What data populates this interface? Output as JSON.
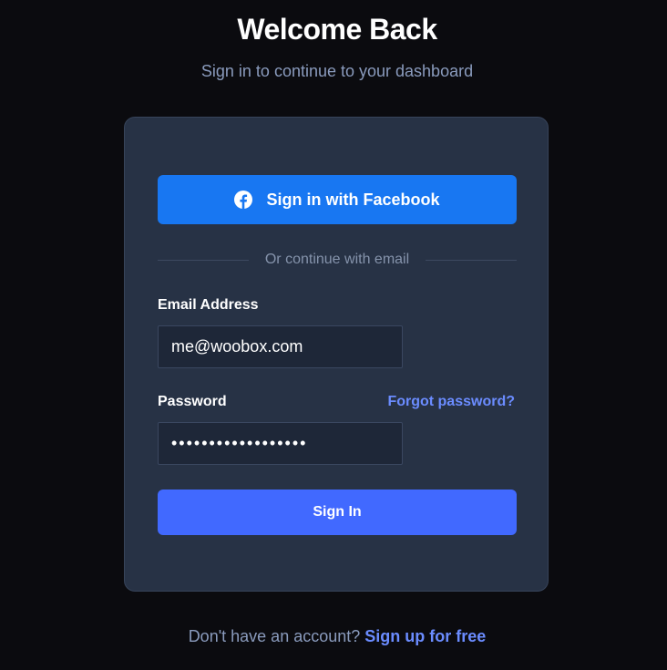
{
  "header": {
    "title": "Welcome Back",
    "subtitle": "Sign in to continue to your dashboard"
  },
  "form": {
    "facebook_button_label": "Sign in with Facebook",
    "facebook_icon": "facebook-icon",
    "divider_text": "Or continue with email",
    "email_label": "Email Address",
    "email_value": "me@woobox.com",
    "password_label": "Password",
    "forgot_password_label": "Forgot password?",
    "password_value": "••••••••••••••••••",
    "signin_button_label": "Sign In"
  },
  "footer": {
    "prompt": "Don't have an account?",
    "signup_label": "Sign up for free"
  },
  "colors": {
    "background": "#0b0b0f",
    "card": "#273245",
    "facebook_blue": "#1877f2",
    "primary": "#4169ff",
    "link": "#6b8cff"
  }
}
